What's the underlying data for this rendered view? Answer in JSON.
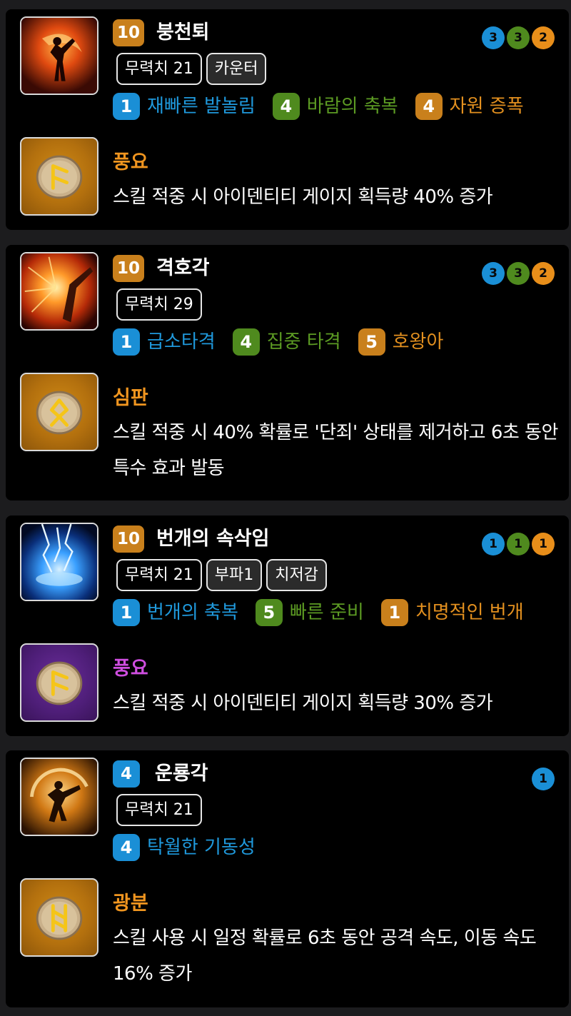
{
  "skills": [
    {
      "level": "10",
      "level_color": "orange",
      "name": "붕천퇴",
      "dots": [
        "3",
        "3",
        "2"
      ],
      "tags": [
        "무력치 21",
        "카운터"
      ],
      "tripods": [
        {
          "level": "1",
          "name": "재빠른 발놀림",
          "color": "blue"
        },
        {
          "level": "4",
          "name": "바람의 축복",
          "color": "green"
        },
        {
          "level": "4",
          "name": "자원 증폭",
          "color": "orange"
        }
      ],
      "rune": {
        "name": "풍요",
        "color": "orange",
        "description": "스킬 적중 시 아이덴티티 게이지 획득량 40% 증가"
      }
    },
    {
      "level": "10",
      "level_color": "orange",
      "name": "격호각",
      "dots": [
        "3",
        "3",
        "2"
      ],
      "tags": [
        "무력치 29"
      ],
      "tripods": [
        {
          "level": "1",
          "name": "급소타격",
          "color": "blue"
        },
        {
          "level": "4",
          "name": "집중 타격",
          "color": "green"
        },
        {
          "level": "5",
          "name": "호왕아",
          "color": "orange"
        }
      ],
      "rune": {
        "name": "심판",
        "color": "orange",
        "description": "스킬 적중 시 40% 확률로 '단죄' 상태를 제거하고 6초 동안 특수 효과 발동"
      }
    },
    {
      "level": "10",
      "level_color": "orange",
      "name": "번개의 속삭임",
      "dots": [
        "1",
        "1",
        "1"
      ],
      "tags": [
        "무력치 21",
        "부파1",
        "치저감"
      ],
      "tripods": [
        {
          "level": "1",
          "name": "번개의 축복",
          "color": "blue"
        },
        {
          "level": "5",
          "name": "빠른 준비",
          "color": "green"
        },
        {
          "level": "1",
          "name": "치명적인 번개",
          "color": "orange"
        }
      ],
      "rune": {
        "name": "풍요",
        "color": "purple",
        "description": "스킬 적중 시 아이덴티티 게이지 획득량 30% 증가"
      }
    },
    {
      "level": "4",
      "level_color": "blue",
      "name": "운룡각",
      "dots": [
        "1"
      ],
      "tags": [
        "무력치 21"
      ],
      "tripods": [
        {
          "level": "4",
          "name": "탁월한 기동성",
          "color": "blue"
        }
      ],
      "rune": {
        "name": "광분",
        "color": "orange",
        "description": "스킬 사용 시 일정 확률로 6초 동안 공격 속도, 이동 속도 16% 증가"
      }
    }
  ],
  "colors": {
    "blue": "#1a8fd6",
    "green": "#4f8a1e",
    "orange": "#c9801c",
    "rune_purple": "#cf4ee0",
    "rune_orange": "#f0951f"
  },
  "icons": [
    "skill-kick-fire-icon",
    "skill-fire-burst-icon",
    "skill-lightning-icon",
    "skill-spin-kick-icon",
    "rune-stone-icon"
  ]
}
